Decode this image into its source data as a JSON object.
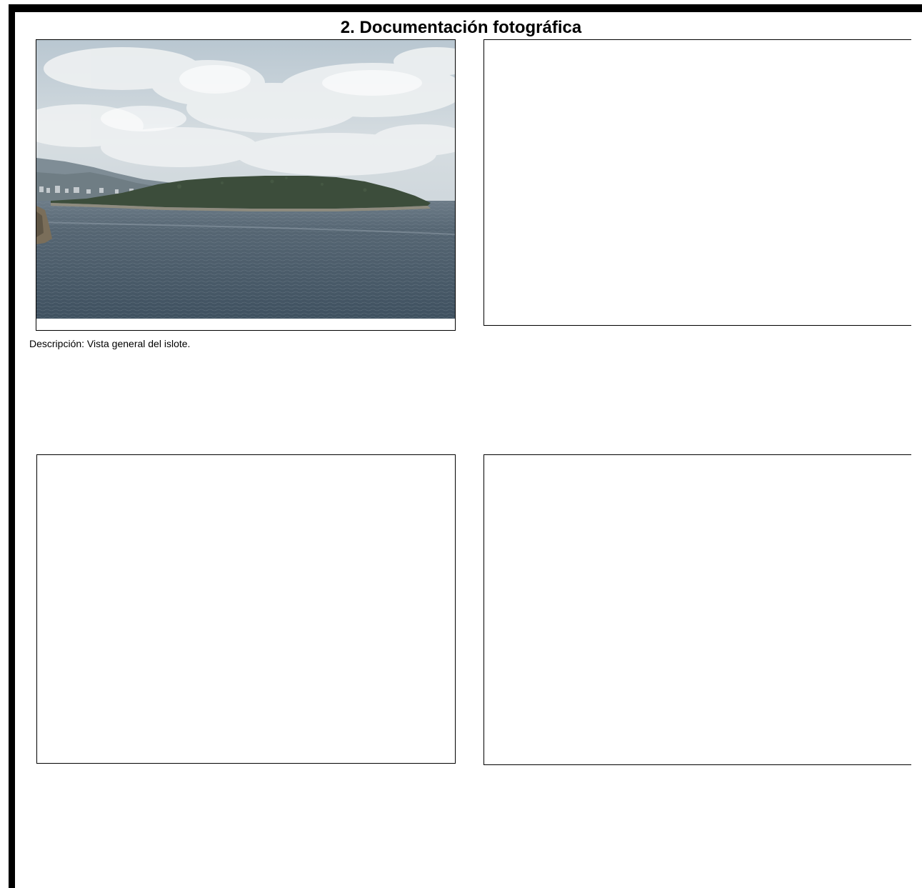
{
  "section": {
    "title": "2. Documentación fotográfica"
  },
  "photos": [
    {
      "subject": "island-in-sea",
      "caption": "Descripción: Vista general del islote."
    },
    {
      "subject": "empty"
    },
    {
      "subject": "empty"
    },
    {
      "subject": "empty"
    }
  ],
  "colors": {
    "border": "#000000",
    "sky": "#c9d4db",
    "cloud": "#eef1f2",
    "island": "#3c4d3b",
    "sea": "#4a5a68",
    "hills": "#7f8d96"
  }
}
